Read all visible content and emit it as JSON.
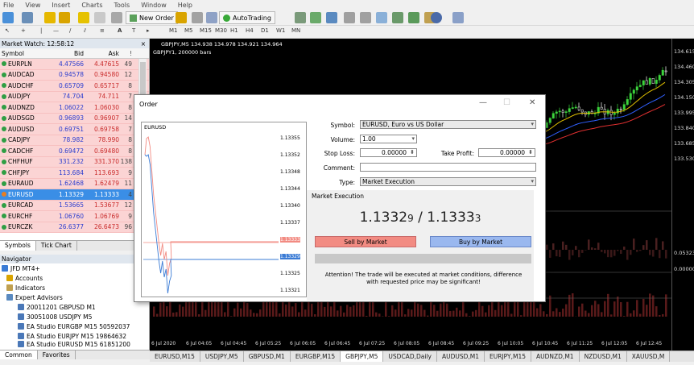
{
  "menu": [
    "File",
    "View",
    "Insert",
    "Charts",
    "Tools",
    "Window",
    "Help"
  ],
  "toolbar": {
    "new_order": "New Order",
    "auto_trading": "AutoTrading",
    "timeframes": [
      "M1",
      "M5",
      "M15",
      "M30",
      "H1",
      "H4",
      "D1",
      "W1",
      "MN"
    ]
  },
  "market_watch": {
    "title": "Market Watch: 12:58:12",
    "headers": [
      "Symbol",
      "Bid",
      "Ask",
      "!"
    ],
    "rows": [
      {
        "s": "EURPLN",
        "b": "4.47566",
        "a": "4.47615",
        "x": "49"
      },
      {
        "s": "AUDCAD",
        "b": "0.94578",
        "a": "0.94580",
        "x": "12"
      },
      {
        "s": "AUDCHF",
        "b": "0.65709",
        "a": "0.65717",
        "x": "8"
      },
      {
        "s": "AUDJPY",
        "b": "74.704",
        "a": "74.711",
        "x": "7"
      },
      {
        "s": "AUDNZD",
        "b": "1.06022",
        "a": "1.06030",
        "x": "8"
      },
      {
        "s": "AUDSGD",
        "b": "0.96893",
        "a": "0.96907",
        "x": "14"
      },
      {
        "s": "AUDUSD",
        "b": "0.69751",
        "a": "0.69758",
        "x": "7"
      },
      {
        "s": "CADJPY",
        "b": "78.982",
        "a": "78.990",
        "x": "8"
      },
      {
        "s": "CADCHF",
        "b": "0.69472",
        "a": "0.69480",
        "x": "8"
      },
      {
        "s": "CHFHUF",
        "b": "331.232",
        "a": "331.370",
        "x": "138"
      },
      {
        "s": "CHFJPY",
        "b": "113.684",
        "a": "113.693",
        "x": "9"
      },
      {
        "s": "EURAUD",
        "b": "1.62468",
        "a": "1.62479",
        "x": "11"
      },
      {
        "s": "EURUSD",
        "b": "1.13329",
        "a": "1.13333",
        "x": "4",
        "sel": true
      },
      {
        "s": "EURCAD",
        "b": "1.53665",
        "a": "1.53677",
        "x": "12"
      },
      {
        "s": "EURCHF",
        "b": "1.06760",
        "a": "1.06769",
        "x": "9"
      },
      {
        "s": "EURCZK",
        "b": "26.6377",
        "a": "26.6473",
        "x": "96"
      }
    ],
    "tabs": [
      "Symbols",
      "Tick Chart"
    ]
  },
  "navigator": {
    "title": "Navigator",
    "items": [
      "JFD MT4+",
      "Accounts",
      "Indicators",
      "Expert Advisors",
      "20011201 GBPUSD M1",
      "30051008 USDJPY M5",
      "EA Studio EURGBP M15 50592037",
      "EA Studio EURJPY M15 19864632",
      "EA Studio EURUSD M15 61851200"
    ],
    "tabs": [
      "Common",
      "Favorites"
    ]
  },
  "chart": {
    "header": "GBPJPY,M5  134.938 134.978 134.921 134.964",
    "sub": "GBPJPY1, 200000 bars",
    "prices": [
      "134.615",
      "134.460",
      "134.305",
      "134.150",
      "133.995",
      "133.840",
      "133.685",
      "133.530"
    ],
    "osc_labels": [
      "0.05323",
      "0.00000"
    ],
    "times": [
      "6 Jul 2020",
      "6 Jul 04:05",
      "6 Jul 04:45",
      "6 Jul 05:25",
      "6 Jul 06:05",
      "6 Jul 06:45",
      "6 Jul 07:25",
      "6 Jul 08:05",
      "6 Jul 08:45",
      "6 Jul 09:25",
      "6 Jul 10:05",
      "6 Jul 10:45",
      "6 Jul 11:25",
      "6 Jul 12:05",
      "6 Jul 12:45"
    ],
    "tabs": [
      "EURUSD,M15",
      "USDJPY,M5",
      "GBPUSD,M1",
      "EURGBP,M15",
      "GBPJPY,M5",
      "USDCAD,Daily",
      "AUDUSD,M1",
      "EURJPY,M15",
      "AUDNZD,M1",
      "NZDUSD,M1",
      "XAUUSD,M"
    ],
    "active_tab": "GBPJPY,M5"
  },
  "order": {
    "title": "Order",
    "mini": {
      "symbol": "EURUSD",
      "prices": [
        "1.13355",
        "1.13352",
        "1.13348",
        "1.13344",
        "1.13340",
        "1.13337",
        "1.13333",
        "1.13329",
        "1.13325",
        "1.13321"
      ]
    },
    "symbol_label": "Symbol:",
    "symbol_value": "EURUSD, Euro vs US Dollar",
    "volume_label": "Volume:",
    "volume_value": "1.00",
    "sl_label": "Stop Loss:",
    "sl_value": "0.00000",
    "tp_label": "Take Profit:",
    "tp_value": "0.00000",
    "comment_label": "Comment:",
    "comment_value": "",
    "type_label": "Type:",
    "type_value": "Market Execution",
    "exec_title": "Market Execution",
    "quote_bid_main": "1.1332",
    "quote_bid_small": "9",
    "quote_sep": " / ",
    "quote_ask_main": "1.1333",
    "quote_ask_small": "3",
    "sell_label": "Sell by Market",
    "buy_label": "Buy by Market",
    "note": "Attention! The trade will be executed at market conditions, difference with requested price may be significant!"
  },
  "colors": {
    "sell": "#f28b82",
    "buy": "#9ab8ef",
    "bull": "#3cd43c",
    "bear": "#ffffff"
  }
}
